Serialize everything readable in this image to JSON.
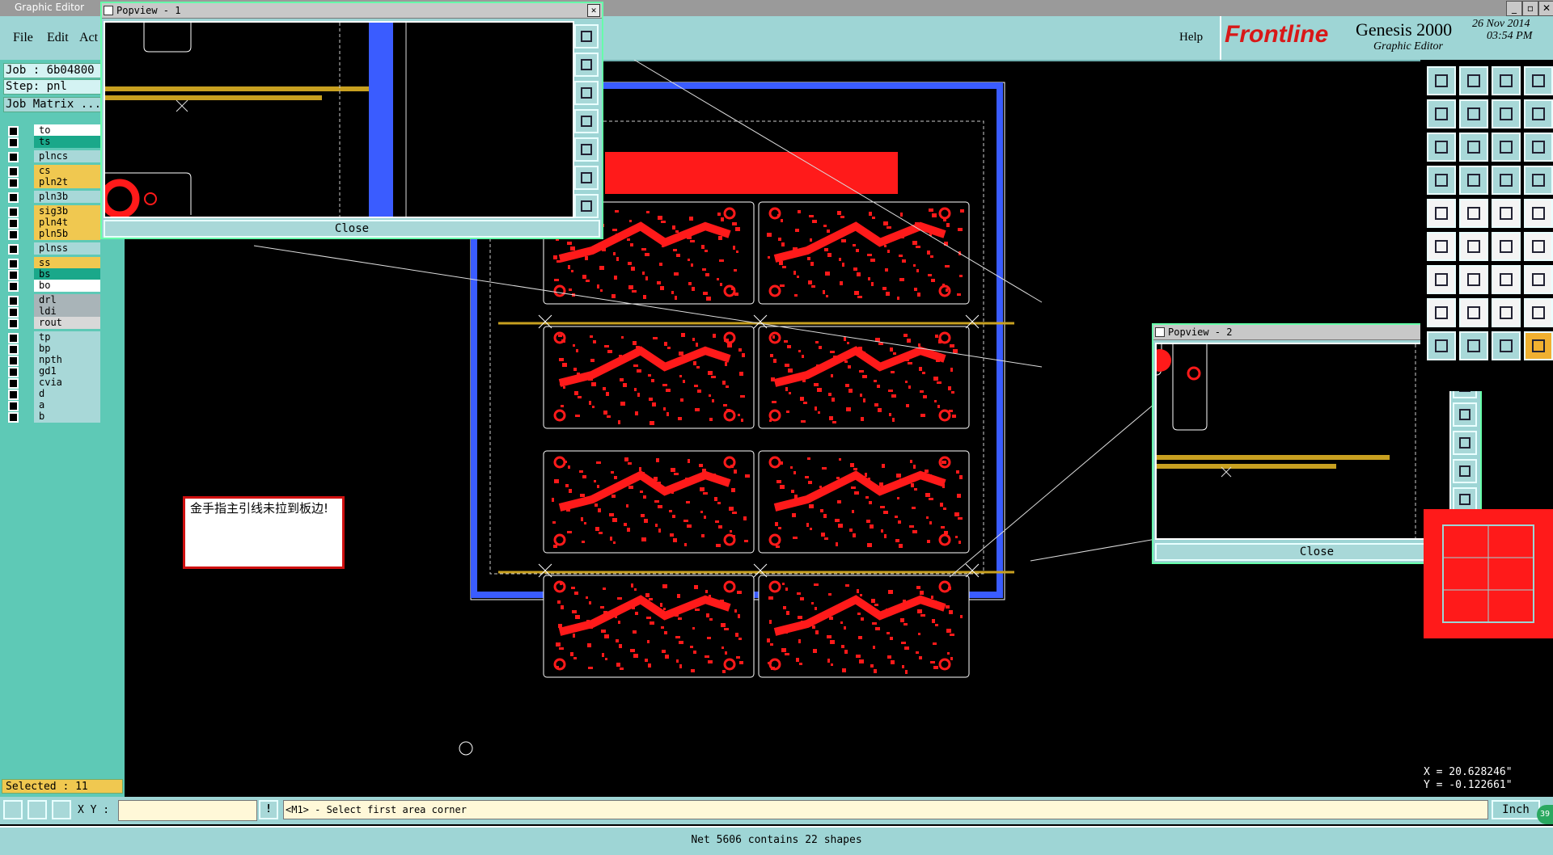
{
  "window": {
    "title": "Graphic Editor"
  },
  "menu": {
    "file": "File",
    "edit": "Edit",
    "actions": "Act",
    "help": "Help"
  },
  "brand": {
    "company": "Frontline",
    "product": "Genesis 2000",
    "subtitle": "Graphic Editor",
    "date": "26 Nov 2014",
    "time": "03:54 PM"
  },
  "job": {
    "job": "Job : 6b04800",
    "step": "Step: pnl",
    "matrix": "Job Matrix ..."
  },
  "layers": [
    {
      "name": "to",
      "color": "#ffffff"
    },
    {
      "name": "ts",
      "color": "#1aa88a"
    },
    {
      "name": "plncs",
      "color": "#a8d8d8"
    },
    {
      "name": "cs",
      "color": "#f0c850"
    },
    {
      "name": "pln2t",
      "color": "#f0c850"
    },
    {
      "name": "pln3b",
      "color": "#a8d8d8"
    },
    {
      "name": "sig3b",
      "color": "#f0c850"
    },
    {
      "name": "pln4t",
      "color": "#f0c850"
    },
    {
      "name": "pln5b",
      "color": "#f0c850"
    },
    {
      "name": "plnss",
      "color": "#a8d8d8"
    },
    {
      "name": "ss",
      "color": "#f0c850"
    },
    {
      "name": "bs",
      "color": "#1aa88a"
    },
    {
      "name": "bo",
      "color": "#ffffff"
    },
    {
      "name": "drl",
      "color": "#a9b4b8"
    },
    {
      "name": "ldi",
      "color": "#a9b4b8"
    },
    {
      "name": "rout",
      "color": "#d8d8d8"
    },
    {
      "name": "tp",
      "color": "#a8d8d8"
    },
    {
      "name": "bp",
      "color": "#a8d8d8"
    },
    {
      "name": "npth",
      "color": "#a8d8d8"
    },
    {
      "name": "gd1",
      "color": "#a8d8d8"
    },
    {
      "name": "cvia",
      "color": "#a8d8d8"
    },
    {
      "name": "d",
      "color": "#a8d8d8"
    },
    {
      "name": "a",
      "color": "#a8d8d8"
    },
    {
      "name": "b",
      "color": "#a8d8d8"
    }
  ],
  "selected": "Selected : 11",
  "popview1": {
    "title": "Popview - 1",
    "close": "Close"
  },
  "popview2": {
    "title": "Popview - 2",
    "close": "Close"
  },
  "note": {
    "text": "金手指主引线未拉到板边!"
  },
  "coords": {
    "x": "X = 20.628246\"",
    "y": "Y = -0.122661\""
  },
  "bottom": {
    "xy_label": "X Y :",
    "xy_value": "",
    "prompt": "<M1> - Select first area corner",
    "units": "Inch",
    "badge": "39"
  },
  "status": {
    "message": "Net 5606 contains 22 shapes"
  },
  "colors": {
    "panel": "#9ed5d5",
    "copper": "#ff1a1a",
    "outline_blue": "#3a5cff",
    "gold": "#c8a020"
  }
}
